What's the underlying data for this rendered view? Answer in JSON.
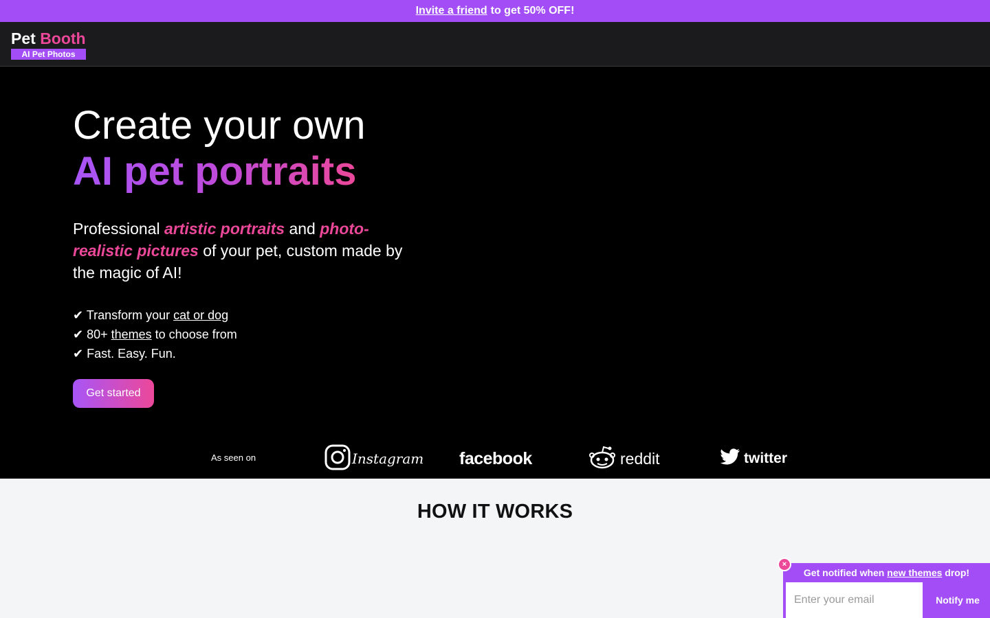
{
  "promo": {
    "link_text": "Invite a friend",
    "rest_text": "to get 50% OFF!"
  },
  "nav": {
    "logo_pet": "Pet",
    "logo_booth": "Booth",
    "logo_sub": "AI Pet Photos"
  },
  "hero": {
    "title_line1": "Create your own",
    "title_line2": "AI pet portraits",
    "lead": {
      "part1": "Professional ",
      "em1": "artistic portraits",
      "part2": " and ",
      "em2": "photo-realistic pictures",
      "part3": " of your pet, custom made by the magic of AI!"
    },
    "bullets": {
      "b1_prefix": "✔ Transform your ",
      "b1_link": "cat or dog",
      "b2_prefix": "✔ 80+ ",
      "b2_link": "themes",
      "b2_suffix": " to choose from",
      "b3": "✔ Fast. Easy. Fun."
    },
    "cta_label": "Get started"
  },
  "seen_on": {
    "label": "As seen on",
    "brands": {
      "instagram": "Instagram",
      "facebook": "facebook",
      "reddit": "reddit",
      "twitter": "twitter"
    }
  },
  "how": {
    "title": "HOW IT WORKS"
  },
  "notify": {
    "text_prefix": "Get notified when ",
    "text_link": "new themes",
    "text_suffix": " drop!",
    "email_placeholder": "Enter your email",
    "button_label": "Notify me",
    "close_symbol": "×"
  },
  "colors": {
    "accent_purple": "#a24df5",
    "accent_pink": "#ec4899",
    "nav_bg": "#1b1b1d",
    "section_bg": "#f4f5f7"
  },
  "icons": [
    "instagram-icon",
    "reddit-icon",
    "twitter-icon",
    "close-icon"
  ]
}
